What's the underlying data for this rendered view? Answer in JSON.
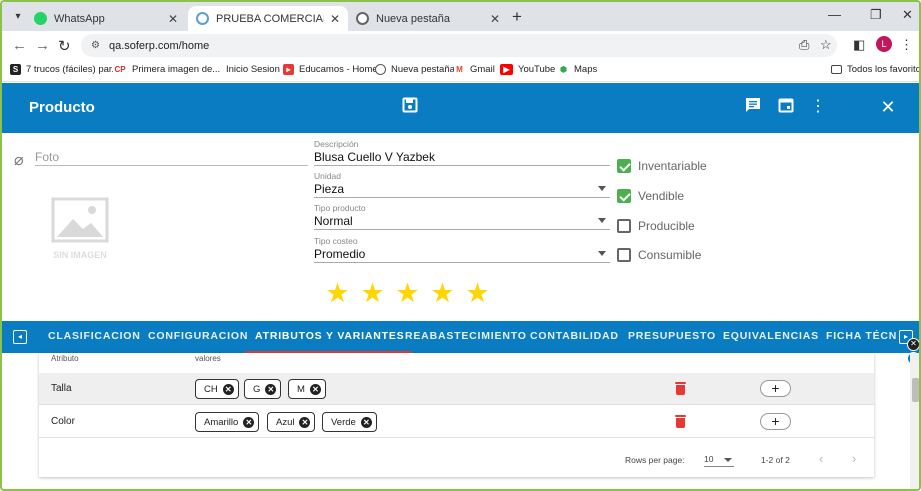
{
  "browser": {
    "tabs": [
      {
        "label": "WhatsApp",
        "active": false
      },
      {
        "label": "PRUEBA COMERCIALIZADORA",
        "active": true
      },
      {
        "label": "Nueva pestaña",
        "active": false
      }
    ],
    "url": "qa.soferp.com/home",
    "avatar_letter": "L",
    "bookmarks": [
      {
        "label": "7 trucos (fáciles) par..."
      },
      {
        "label": "Primera imagen de..."
      },
      {
        "label": "Inicio Sesion"
      },
      {
        "label": "Educamos - Home"
      },
      {
        "label": "Nueva pestaña"
      },
      {
        "label": "Gmail"
      },
      {
        "label": "YouTube"
      },
      {
        "label": "Maps"
      }
    ],
    "all_bookmarks": "Todos los favoritos"
  },
  "header": {
    "title": "Producto",
    "color": "#0a7cc1"
  },
  "form": {
    "photo_placeholder": "Foto",
    "image_placeholder": "SIN IMAGEN",
    "description": {
      "label": "Descripción",
      "value": "Blusa Cuello V Yazbek"
    },
    "unit": {
      "label": "Unidad",
      "value": "Pieza"
    },
    "product_type": {
      "label": "Tipo producto",
      "value": "Normal"
    },
    "cost_type": {
      "label": "Tipo costeo",
      "value": "Promedio"
    },
    "checks": [
      {
        "label": "Inventariable",
        "checked": true
      },
      {
        "label": "Vendible",
        "checked": true
      },
      {
        "label": "Producible",
        "checked": false
      },
      {
        "label": "Consumible",
        "checked": false
      }
    ],
    "rating": 5
  },
  "sections": {
    "tabs": [
      "CLASIFICACION",
      "CONFIGURACION",
      "ATRIBUTOS Y VARIANTES",
      "REABASTECIMIENTO",
      "CONTABILIDAD",
      "PRESUPUESTO",
      "EQUIVALENCIAS",
      "FICHA TÉCN"
    ],
    "selected": "ATRIBUTOS Y VARIANTES"
  },
  "table": {
    "columns": [
      "Atributo",
      "valores"
    ],
    "rows": [
      {
        "attribute": "Talla",
        "values": [
          "CH",
          "G",
          "M"
        ]
      },
      {
        "attribute": "Color",
        "values": [
          "Amarillo",
          "Azul",
          "Verde"
        ]
      }
    ],
    "rows_per_page_label": "Rows per page:",
    "rows_per_page": "10",
    "range": "1-2 of 2"
  }
}
